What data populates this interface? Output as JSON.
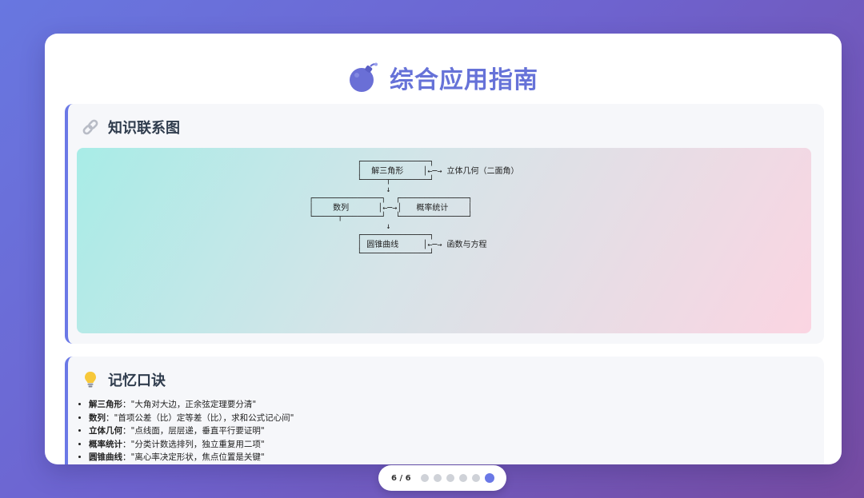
{
  "title": {
    "text": "综合应用指南",
    "icon": "bomb-icon"
  },
  "knowledge_section": {
    "icon": "link-icon",
    "title": "知识联系图",
    "diagram": "          ┌──────────────┐\n          │  解三角形    │←─→ 立体几何（二面角）\n          └─────┬────────┘\n                ↓\n┌──────────────┐  ┌──────────────┐\n│    数列      │←─→│   概率统计    │\n└─────┬────────┘  └──────────────┘\n                ↓\n          ┌──────────────┐\n          │ 圆锥曲线     │←─→ 函数与方程\n          └──────────────┘"
  },
  "memory_section": {
    "icon": "lightbulb-icon",
    "title": "记忆口诀",
    "items": [
      {
        "term": "解三角形",
        "text": "：\"大角对大边，正余弦定理要分清\""
      },
      {
        "term": "数列",
        "text": "：\"首项公差（比）定等差（比），求和公式记心间\""
      },
      {
        "term": "立体几何",
        "text": "：\"点线面，层层递，垂直平行要证明\""
      },
      {
        "term": "概率统计",
        "text": "：\"分类计数选排列，独立重复用二项\""
      },
      {
        "term": "圆锥曲线",
        "text": "：\"离心率决定形状，焦点位置是关键\""
      }
    ]
  },
  "pager": {
    "label": "6 / 6",
    "total": 6,
    "current": 6
  },
  "colors": {
    "accent": "#6a78e6",
    "title": "#6672d8"
  }
}
